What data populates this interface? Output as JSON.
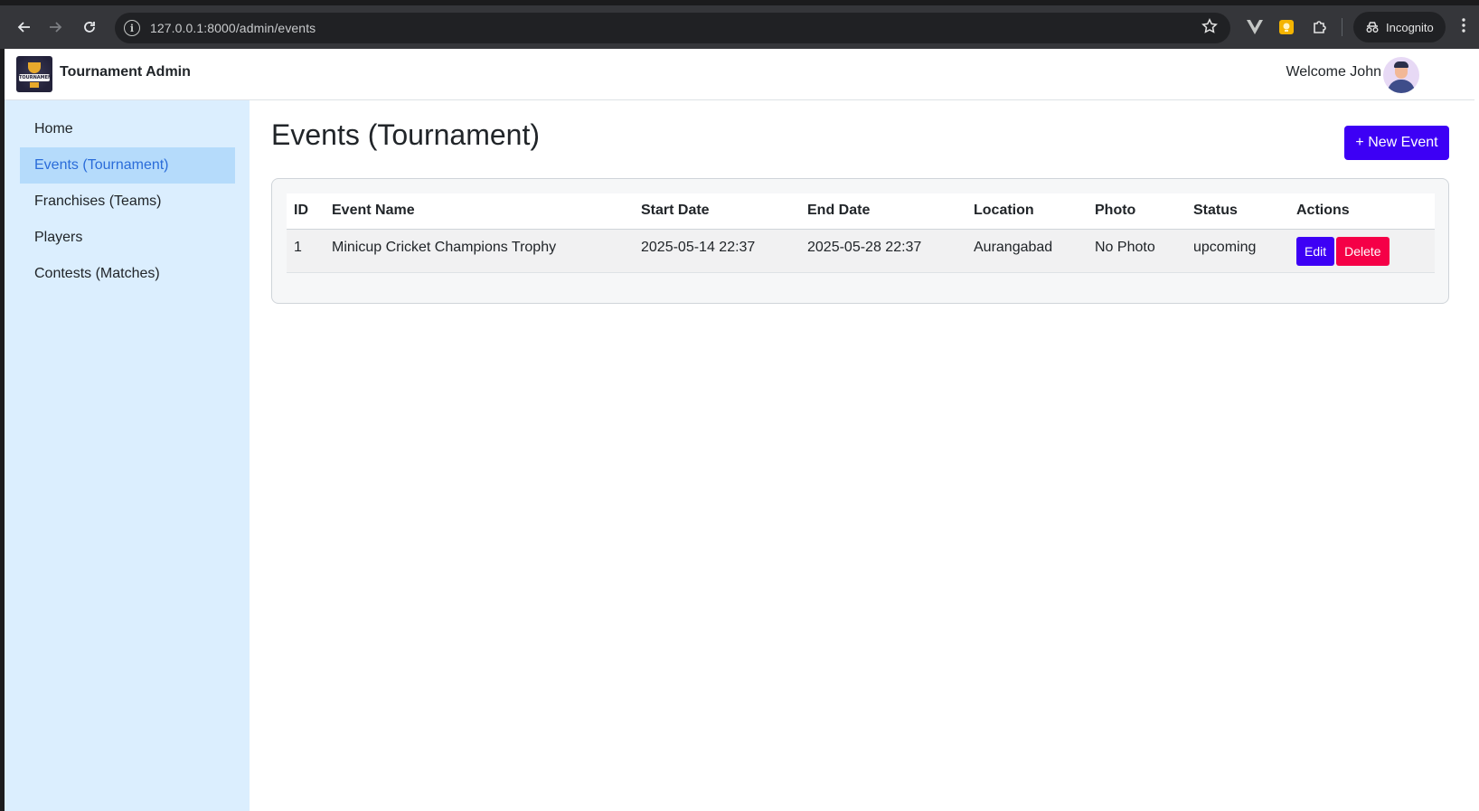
{
  "browser": {
    "url": "127.0.0.1:8000/admin/events",
    "incognito_label": "Incognito",
    "icons": [
      "back-arrow-icon",
      "forward-arrow-icon",
      "reload-icon",
      "site-info-icon",
      "bookmark-star-icon",
      "vue-devtools-icon",
      "extension-yellow-icon",
      "extensions-puzzle-icon",
      "incognito-icon",
      "kebab-menu-icon"
    ]
  },
  "navbar": {
    "brand_title": "Tournament Admin",
    "logo_text": "TOURNAMENT",
    "welcome_text": "Welcome John"
  },
  "sidebar": {
    "items": [
      {
        "label": "Home",
        "active": false
      },
      {
        "label": "Events (Tournament)",
        "active": true
      },
      {
        "label": "Franchises (Teams)",
        "active": false
      },
      {
        "label": "Players",
        "active": false
      },
      {
        "label": "Contests (Matches)",
        "active": false
      }
    ]
  },
  "main": {
    "title": "Events (Tournament)",
    "new_button_label": "+ New Event",
    "table": {
      "columns": [
        "ID",
        "Event Name",
        "Start Date",
        "End Date",
        "Location",
        "Photo",
        "Status",
        "Actions"
      ],
      "rows": [
        {
          "id": "1",
          "event_name": "Minicup Cricket Champions Trophy",
          "start_date": "2025-05-14 22:37",
          "end_date": "2025-05-28 22:37",
          "location": "Aurangabad",
          "photo": "No Photo",
          "status": "upcoming",
          "edit_label": "Edit",
          "delete_label": "Delete"
        }
      ]
    }
  },
  "colors": {
    "primary": "#3d00f5",
    "danger": "#f50047",
    "sidebar_bg": "#dbeefe",
    "sidebar_active_bg": "#b5dbfb",
    "sidebar_active_text": "#2a6cd9"
  }
}
